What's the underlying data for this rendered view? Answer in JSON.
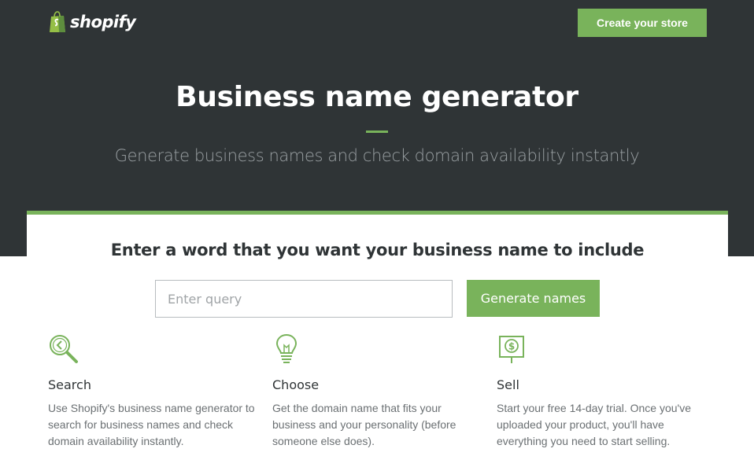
{
  "header": {
    "logo_text": "shopify",
    "logo_icon": "shopping-bag-icon",
    "cta_label": "Create your store"
  },
  "hero": {
    "title": "Business name generator",
    "subtitle": "Generate business names and check domain availability instantly"
  },
  "search": {
    "prompt": "Enter a word that you want your business name to include",
    "placeholder": "Enter query",
    "value": "",
    "button_label": "Generate names"
  },
  "features": [
    {
      "icon": "search-icon",
      "title": "Search",
      "description": "Use Shopify's business name generator to search for business names and check domain availability instantly."
    },
    {
      "icon": "lightbulb-icon",
      "title": "Choose",
      "description": "Get the domain name that fits your business and your personality (before someone else does)."
    },
    {
      "icon": "dollar-sign-icon",
      "title": "Sell",
      "description": "Start your free 14-day trial. Once you've uploaded your product, you'll have everything you need to start selling."
    }
  ],
  "colors": {
    "accent": "#79b35b",
    "hero_background": "#2f3436"
  }
}
